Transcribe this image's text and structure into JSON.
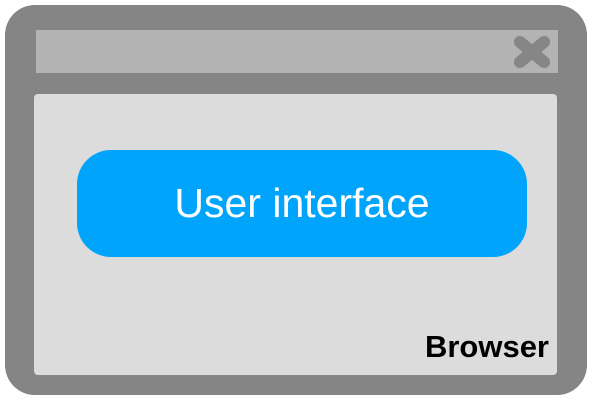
{
  "diagram": {
    "window": {
      "frame_color": "#858585",
      "titlebar_color": "#b3b3b3",
      "content_color": "#dcdcdc",
      "close_icon": "close-icon"
    },
    "ui_box": {
      "label": "User interface",
      "fill_color": "#00a4fb",
      "text_color": "#ffffff"
    },
    "browser_label": "Browser"
  }
}
